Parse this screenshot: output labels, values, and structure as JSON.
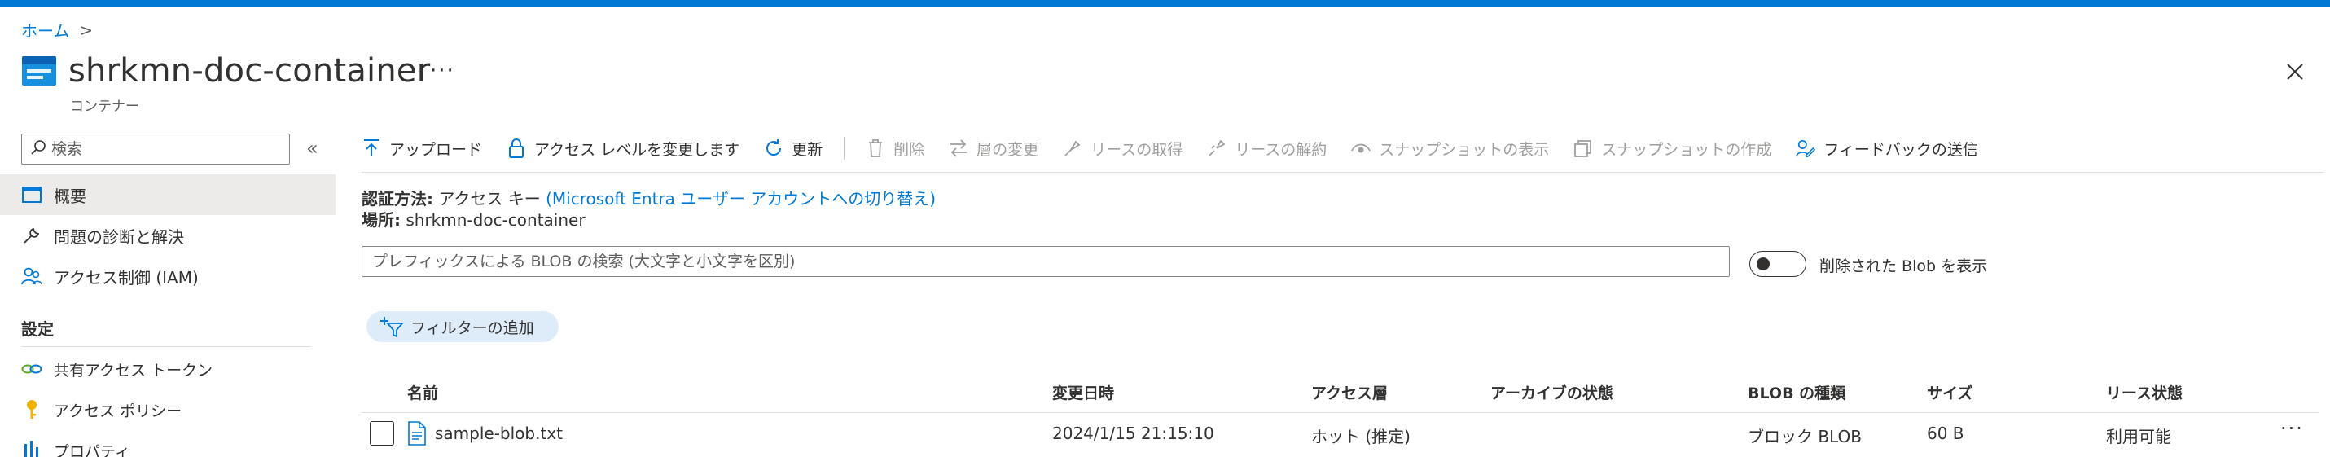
{
  "breadcrumb": {
    "home": "ホーム",
    "separator": ">"
  },
  "header": {
    "title": "shrkmn-doc-container",
    "subtitle": "コンテナー",
    "more": "···"
  },
  "sidebar": {
    "search_placeholder": "検索",
    "collapse": "«",
    "items": [
      {
        "label": "概要",
        "icon": "overview-icon",
        "active": true
      },
      {
        "label": "問題の診断と解決",
        "icon": "wrench-icon"
      },
      {
        "label": "アクセス制御 (IAM)",
        "icon": "users-icon"
      }
    ],
    "section_title": "設定",
    "settings_items": [
      {
        "label": "共有アクセス トークン",
        "icon": "link-icon"
      },
      {
        "label": "アクセス ポリシー",
        "icon": "key-icon"
      },
      {
        "label": "プロパティ",
        "icon": "properties-icon"
      }
    ]
  },
  "toolbar": {
    "upload": "アップロード",
    "change_access": "アクセス レベルを変更します",
    "refresh": "更新",
    "delete": "削除",
    "change_tier": "層の変更",
    "acquire_lease": "リースの取得",
    "break_lease": "リースの解約",
    "view_snapshots": "スナップショットの表示",
    "create_snapshot": "スナップショットの作成",
    "feedback": "フィードバックの送信"
  },
  "info": {
    "auth_label": "認証方法:",
    "auth_value": "アクセス キー",
    "auth_link": "(Microsoft Entra ユーザー アカウントへの切り替え)",
    "location_label": "場所:",
    "location_value": "shrkmn-doc-container"
  },
  "blob_search": {
    "placeholder": "プレフィックスによる BLOB の検索 (大文字と小文字を区別)"
  },
  "show_deleted": {
    "label": "削除された Blob を表示",
    "on": false
  },
  "filter": {
    "label": "フィルターの追加"
  },
  "table": {
    "columns": [
      "名前",
      "変更日時",
      "アクセス層",
      "アーカイブの状態",
      "BLOB の種類",
      "サイズ",
      "リース状態"
    ],
    "rows": [
      {
        "name": "sample-blob.txt",
        "modified": "2024/1/15 21:15:10",
        "tier": "ホット (推定)",
        "archive_status": "",
        "blob_type": "ブロック BLOB",
        "size": "60 B",
        "lease_state": "利用可能",
        "more": "···"
      }
    ]
  },
  "colors": {
    "accent": "#0078d4",
    "active_bg": "#edebe9",
    "pill_bg": "#deecf9"
  }
}
